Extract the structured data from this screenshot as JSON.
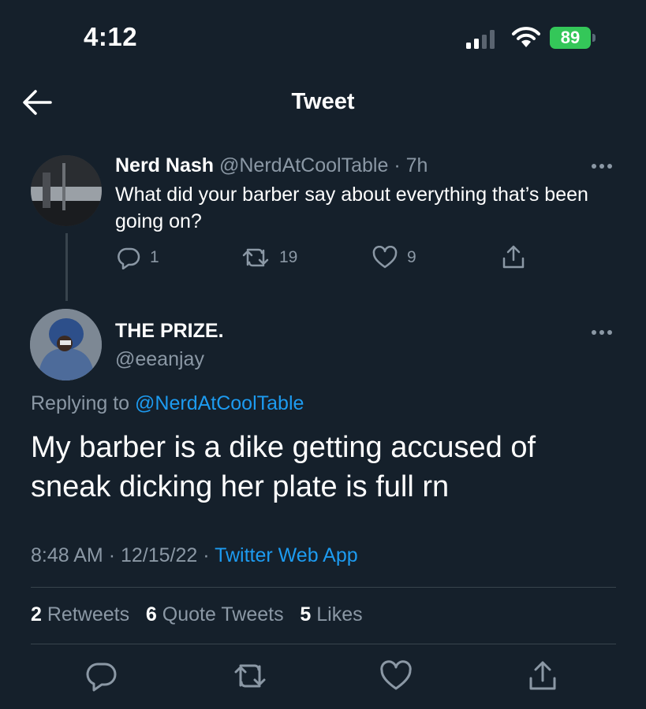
{
  "status_bar": {
    "time": "4:12",
    "battery": "89",
    "battery_color": "#34c759"
  },
  "header": {
    "title": "Tweet",
    "back_icon": "arrow-left-icon"
  },
  "parent_tweet": {
    "name": "Nerd Nash",
    "handle": "@NerdAtCoolTable",
    "time": "7h",
    "text": "What did your barber say about everything that’s been going on?",
    "replies": "1",
    "retweets": "19",
    "likes": "9"
  },
  "main_tweet": {
    "name": "THE PRIZE.",
    "handle": "@eeanjay",
    "replying_prefix": "Replying to",
    "replying_to": "@NerdAtCoolTable",
    "text": "My barber is a dike getting accused of sneak dicking her plate is full rn",
    "time": "8:48 AM",
    "date": "12/15/22",
    "source": "Twitter Web App",
    "stats": {
      "retweets_count": "2",
      "retweets_label": "Retweets",
      "quotes_count": "6",
      "quotes_label": "Quote Tweets",
      "likes_count": "5",
      "likes_label": "Likes"
    }
  },
  "colors": {
    "background": "#15202b",
    "muted": "#8b98a5",
    "link": "#1d9bf0",
    "divider": "#38444d"
  }
}
